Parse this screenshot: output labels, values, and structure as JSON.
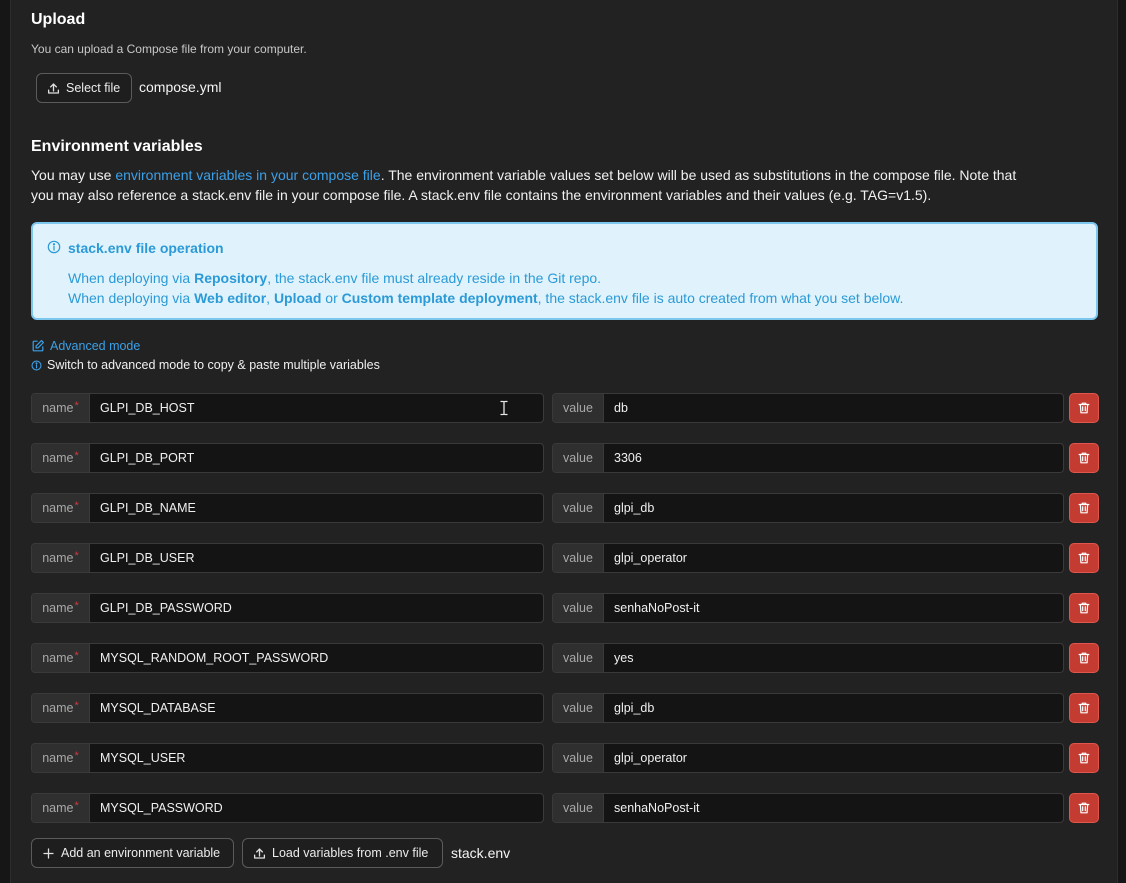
{
  "upload": {
    "title": "Upload",
    "description": "You can upload a Compose file from your computer.",
    "select_button": "Select file",
    "filename": "compose.yml"
  },
  "env": {
    "title": "Environment variables",
    "desc_prefix": "You may use ",
    "desc_link": "environment variables in your compose file",
    "desc_line1_suffix": ". The environment variable values set below will be used as substitutions in the compose file. Note that",
    "desc_line2": "you may also reference a stack.env file in your compose file. A stack.env file contains the environment variables and their values (e.g. TAG=v1.5)."
  },
  "info_box": {
    "title": "stack.env file operation",
    "l1_a": "When deploying via ",
    "l1_b": "Repository",
    "l1_c": ", the stack.env file must already reside in the Git repo.",
    "l2_a": "When deploying via ",
    "l2_b": "Web editor",
    "l2_c": ", ",
    "l2_d": "Upload",
    "l2_e": " or ",
    "l2_f": "Custom template deployment",
    "l2_g": ", the stack.env file is auto created from what you set below."
  },
  "advanced": {
    "link": "Advanced mode",
    "hint": "Switch to advanced mode to copy & paste multiple variables"
  },
  "labels": {
    "name": "name",
    "required": "*",
    "value": "value"
  },
  "variables": [
    {
      "name": "GLPI_DB_HOST",
      "value": "db"
    },
    {
      "name": "GLPI_DB_PORT",
      "value": "3306"
    },
    {
      "name": "GLPI_DB_NAME",
      "value": "glpi_db"
    },
    {
      "name": "GLPI_DB_USER",
      "value": "glpi_operator"
    },
    {
      "name": "GLPI_DB_PASSWORD",
      "value": "senhaNoPost-it"
    },
    {
      "name": "MYSQL_RANDOM_ROOT_PASSWORD",
      "value": "yes"
    },
    {
      "name": "MYSQL_DATABASE",
      "value": "glpi_db"
    },
    {
      "name": "MYSQL_USER",
      "value": "glpi_operator"
    },
    {
      "name": "MYSQL_PASSWORD",
      "value": "senhaNoPost-it"
    }
  ],
  "footer": {
    "add_button": "Add an environment variable",
    "load_button": "Load variables from .env file",
    "env_filename": "stack.env"
  },
  "colors": {
    "accent": "#3ba0e8",
    "danger": "#c43b31",
    "info_bg": "#e0f3fc"
  },
  "icons": [
    "upload-icon",
    "info-icon",
    "edit-icon",
    "trash-icon",
    "plus-icon",
    "text-cursor-icon"
  ]
}
